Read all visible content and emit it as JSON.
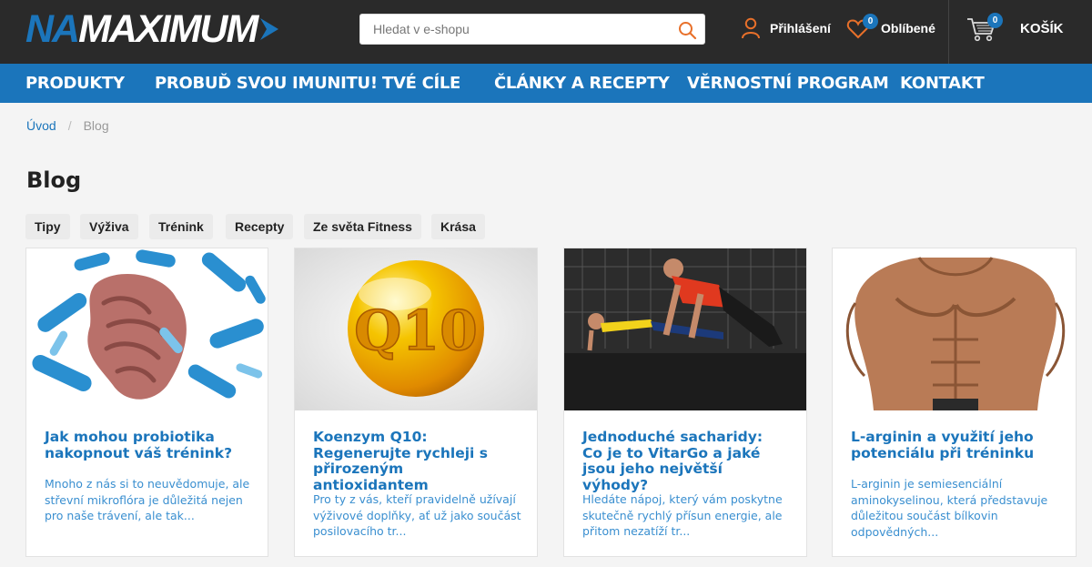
{
  "header": {
    "logo": {
      "part1": "NA",
      "part2": "MAXIMUM"
    },
    "search": {
      "placeholder": "Hledat v e-shopu",
      "value": ""
    },
    "login_label": "Přihlášení",
    "favorites": {
      "label": "Oblíbené",
      "count": "0"
    },
    "cart": {
      "label": "KOŠÍK",
      "count": "0"
    },
    "colors": {
      "accent": "#1b75bb",
      "orange": "#e8702a",
      "topbar": "#2a2a2a"
    }
  },
  "nav": {
    "items": [
      {
        "label": "PRODUKTY"
      },
      {
        "label": "PROBUĎ SVOU IMUNITU!"
      },
      {
        "label": "TVÉ CÍLE"
      },
      {
        "label": "ČLÁNKY A RECEPTY"
      },
      {
        "label": "VĚRNOSTNÍ PROGRAM"
      },
      {
        "label": "KONTAKT"
      }
    ]
  },
  "breadcrumb": {
    "home": "Úvod",
    "separator": "/",
    "current": "Blog"
  },
  "page_title": "Blog",
  "categories": [
    {
      "label": "Tipy"
    },
    {
      "label": "Výživa"
    },
    {
      "label": "Trénink"
    },
    {
      "label": "Recepty"
    },
    {
      "label": "Ze světa Fitness"
    },
    {
      "label": "Krása"
    }
  ],
  "articles": [
    {
      "image": "bacteria-intestine-illustration",
      "title": "Jak mohou probiotika nakopnout váš trénink?",
      "excerpt": "Mnoho z nás si to neuvědomuje, ale střevní mikroflóra je důležitá nejen pro naše trávení, ale tak..."
    },
    {
      "image": "q10-golden-capsule",
      "title": "Koenzym Q10: Regenerujte rychleji s přirozeným antioxidantem",
      "excerpt": "Pro ty z vás, kteří pravidelně užívají výživové doplňky, ať už jako součást posilovacího tr..."
    },
    {
      "image": "couple-doing-pushups-gym",
      "title": "Jednoduché sacharidy: Co je to VitarGo a jaké jsou jeho největší výhody?",
      "excerpt": "Hledáte nápoj, který vám poskytne skutečně rychlý přísun energie, ale přitom nezatíží tr..."
    },
    {
      "image": "muscular-torso",
      "title": "L-arginin a využití jeho potenciálu při tréninku",
      "excerpt": "L-arginin je semiesenciální aminokyselinou, která představuje důležitou součást bílkovin odpovědných..."
    }
  ]
}
